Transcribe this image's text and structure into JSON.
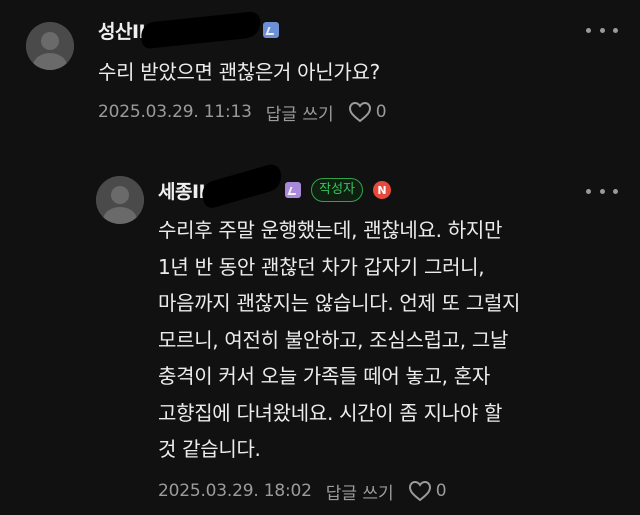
{
  "comments": [
    {
      "author": "성산II",
      "body": "수리 받았으면 괜찮은거 아닌가요?",
      "timestamp": "2025.03.29. 11:13",
      "reply_label": "답글 쓰기",
      "likes": "0",
      "badge_color": "#6c8fd6"
    },
    {
      "author": "세종II",
      "author_badge": "작성자",
      "new_badge": "N",
      "body": "수리후 주말 운행했는데, 괜찮네요. 하지만\n1년 반 동안 괜찮던 차가 갑자기 그러니,\n마음까지 괜찮지는 않습니다. 언제 또 그럴지\n모르니, 여전히 불안하고, 조심스럽고, 그날\n충격이 커서 오늘 가족들 떼어 놓고, 혼자\n고향집에 다녀왔네요. 시간이 좀 지나야 할\n것 같습니다.",
      "timestamp": "2025.03.29. 18:02",
      "reply_label": "답글 쓰기",
      "likes": "0",
      "badge_color": "#a88ad8"
    }
  ],
  "icons": {
    "more": "more-dots-icon",
    "like": "heart-outline-icon",
    "avatar": "default-avatar-icon"
  },
  "colors": {
    "background": "#111111",
    "author_badge_green": "#3cc25b",
    "new_badge_red": "#e64a3c"
  }
}
